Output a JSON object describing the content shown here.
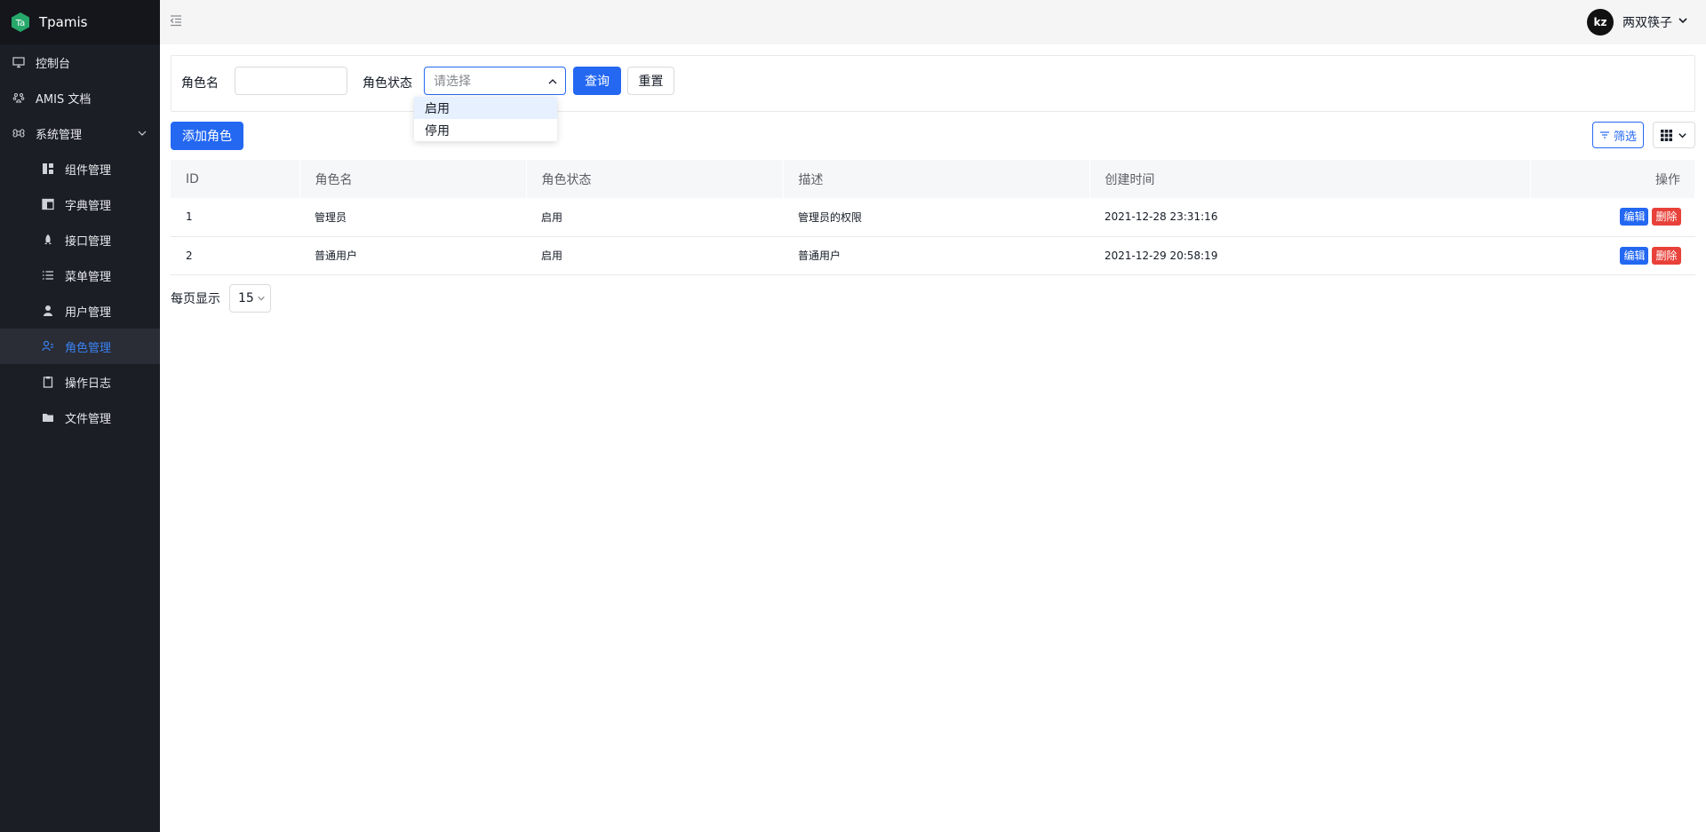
{
  "app": {
    "name": "Tpamis",
    "logo_text": "Ta"
  },
  "sidebar": {
    "items": [
      {
        "label": "控制台",
        "icon": "monitor-icon"
      },
      {
        "label": "AMIS 文档",
        "icon": "paw-icon"
      },
      {
        "label": "系统管理",
        "icon": "command-icon",
        "expanded": true
      }
    ],
    "sub_items": [
      {
        "label": "组件管理",
        "icon": "dashboard-icon"
      },
      {
        "label": "字典管理",
        "icon": "layout-icon"
      },
      {
        "label": "接口管理",
        "icon": "rocket-icon"
      },
      {
        "label": "菜单管理",
        "icon": "list-icon"
      },
      {
        "label": "用户管理",
        "icon": "user-icon"
      },
      {
        "label": "角色管理",
        "icon": "role-icon",
        "active": true
      },
      {
        "label": "操作日志",
        "icon": "clipboard-icon"
      },
      {
        "label": "文件管理",
        "icon": "folder-icon"
      }
    ]
  },
  "header": {
    "user_name": "两双筷子",
    "avatar_text": "kz"
  },
  "filter": {
    "role_name_label": "角色名",
    "role_name_value": "",
    "status_label": "角色状态",
    "status_placeholder": "请选择",
    "search_label": "查询",
    "reset_label": "重置",
    "options": [
      "启用",
      "停用"
    ]
  },
  "toolbar": {
    "add_label": "添加角色",
    "filter_label": "筛选"
  },
  "table": {
    "columns": [
      "ID",
      "角色名",
      "角色状态",
      "描述",
      "创建时间",
      "操作"
    ],
    "rows": [
      {
        "id": "1",
        "name": "管理员",
        "status": "启用",
        "desc": "管理员的权限",
        "created": "2021-12-28 23:31:16"
      },
      {
        "id": "2",
        "name": "普通用户",
        "status": "启用",
        "desc": "普通用户",
        "created": "2021-12-29 20:58:19"
      }
    ],
    "edit_label": "编辑",
    "delete_label": "删除"
  },
  "pagination": {
    "per_page_label": "每页显示",
    "per_page_value": "15"
  },
  "colors": {
    "primary": "#2468f2",
    "danger": "#e8413a",
    "sidebar_bg": "#1c1e26",
    "brand_green": "#27a86b"
  }
}
